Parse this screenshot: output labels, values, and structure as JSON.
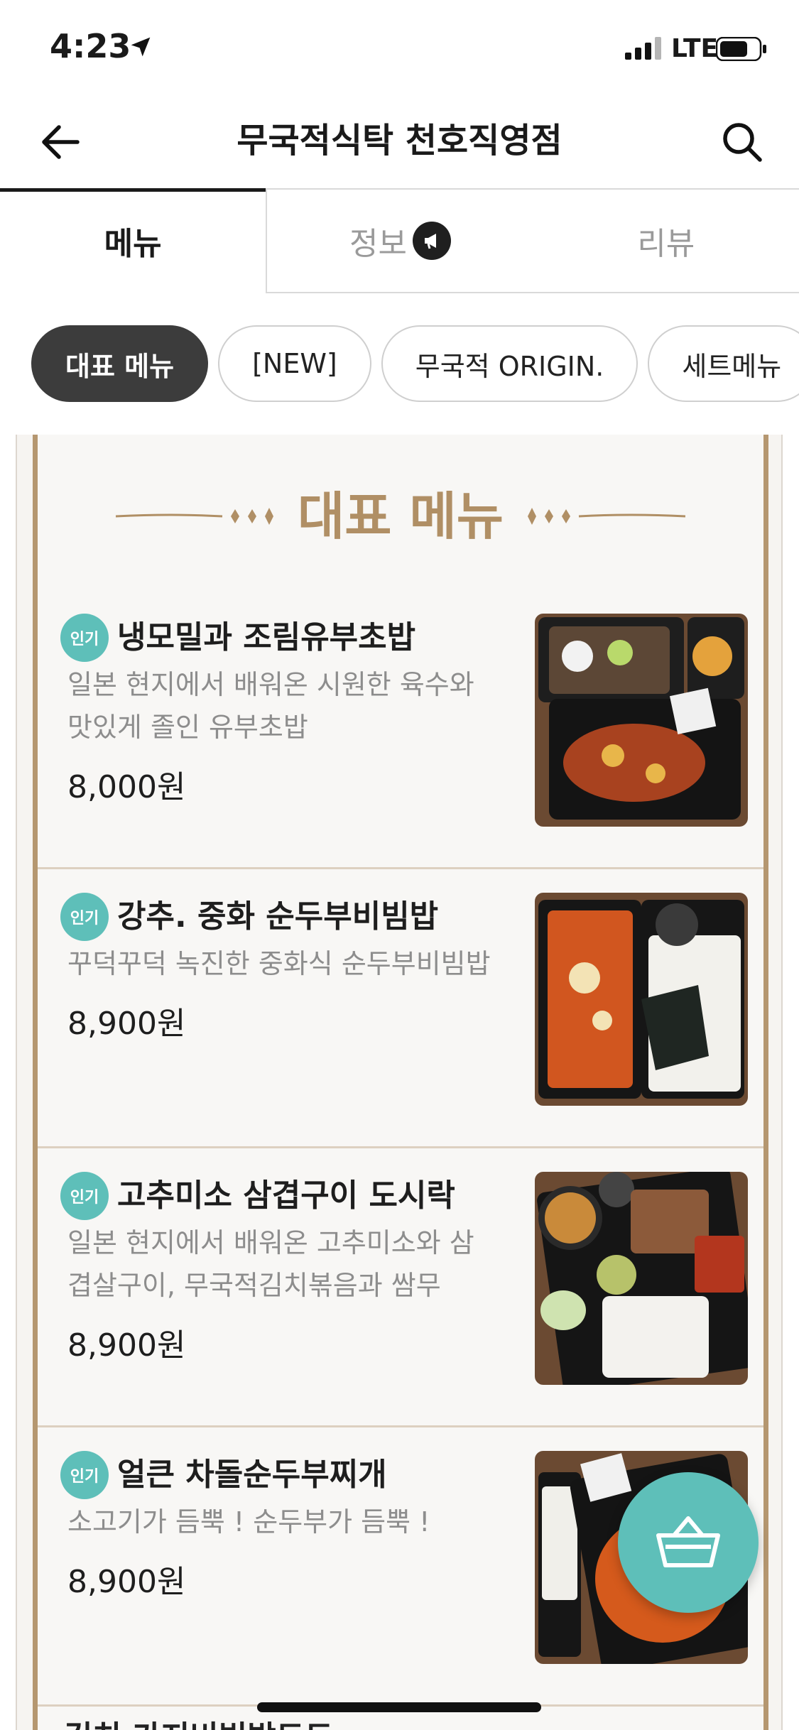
{
  "status": {
    "time": "4:23",
    "network": "LTE"
  },
  "nav": {
    "title": "무국적식탁 천호직영점"
  },
  "tabs": [
    {
      "label": "메뉴"
    },
    {
      "label": "정보"
    },
    {
      "label": "리뷰"
    }
  ],
  "chips": [
    {
      "label": "대표 메뉴"
    },
    {
      "label": "[NEW]"
    },
    {
      "label": "무국적 ORIGIN."
    },
    {
      "label": "세트메뉴"
    }
  ],
  "board": {
    "title": "대표 메뉴"
  },
  "items": [
    {
      "badge": "인기",
      "name": "냉모밀과 조림유부초밥",
      "desc": "일본 현지에서 배워온 시원한 육수와 맛있게 졸인 유부초밥",
      "price": "8,000원"
    },
    {
      "badge": "인기",
      "name": "강추. 중화 순두부비빔밥",
      "desc": "꾸덕꾸덕 녹진한 중화식 순두부비빔밥",
      "price": "8,900원"
    },
    {
      "badge": "인기",
      "name": "고추미소 삼겹구이 도시락",
      "desc": "일본 현지에서 배워온 고추미소와 삼겹살구이, 무국적김치볶음과 쌈무",
      "price": "8,900원"
    },
    {
      "badge": "인기",
      "name": "얼큰 차돌순두부찌개",
      "desc": "소고기가 듬뿍 ! 순두부가 듬뿍 !",
      "price": "8,900원"
    }
  ],
  "partial_next_item": "김치 가지비빔밥도도",
  "colors": {
    "accent": "#5ebfb9",
    "gold": "#b08f65",
    "chip_active": "#3c3c3c"
  }
}
